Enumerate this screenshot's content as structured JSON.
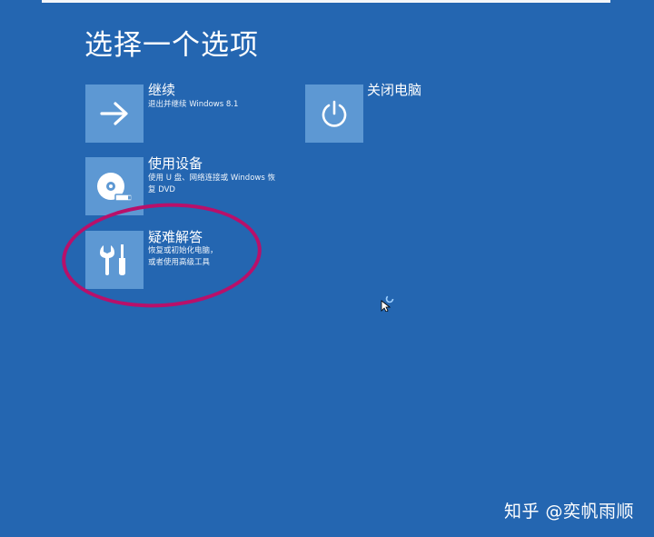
{
  "page": {
    "title": "选择一个选项"
  },
  "options": {
    "continue": {
      "title": "继续",
      "desc": "退出并继续 Windows 8.1",
      "icon": "arrow-right-icon"
    },
    "use_device": {
      "title": "使用设备",
      "desc": "使用 U 盘、网络连接或 Windows 恢复 DVD",
      "icon": "disc-drive-icon"
    },
    "troubleshoot": {
      "title": "疑难解答",
      "desc_line1": "恢复或初始化电脑，",
      "desc_line2": "或者使用高级工具",
      "icon": "tools-icon"
    },
    "shutdown": {
      "title": "关闭电脑",
      "icon": "power-icon"
    }
  },
  "watermark": {
    "text": "知乎 @奕帆雨顺"
  },
  "colors": {
    "background": "#2466b1",
    "tile": "#5d98d3",
    "highlight": "#b8106a"
  }
}
